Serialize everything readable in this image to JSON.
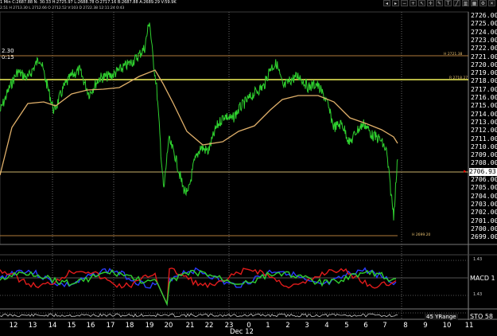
{
  "header": {
    "ohlc_line": "1 Min  C:2687.88  N: 30.33  H:2725.97  L:2688.78  O:2717.16  B:2687.88  A:2689.29  V:59.9K",
    "sub_line": "2.51  H 2713.30  L 2712.66  O 2712.52  V:103  D 2722.38  12:11:24  0:43",
    "left_value_1": "2.30",
    "left_value_2": "0:15"
  },
  "price_axis": {
    "ticks": [
      "2726.00",
      "2725.00",
      "2724.00",
      "2723.00",
      "2722.00",
      "2721.00",
      "2720.00",
      "2719.00",
      "2718.00",
      "2717.00",
      "2716.00",
      "2715.00",
      "2714.00",
      "2713.00",
      "2712.00",
      "2711.00",
      "2710.00",
      "2709.00",
      "2708.00",
      "2707.00",
      "2706.00",
      "2705.00",
      "2704.00",
      "2703.00",
      "2702.00",
      "2701.00",
      "2700.00",
      "2699.00"
    ],
    "current_price": "2706.93"
  },
  "level_labels": {
    "upper": "H 2721.38",
    "yellow": "R 2718.27",
    "lower": "H 2699.20"
  },
  "indicators": {
    "macd_label": "MACD 1",
    "macd_upper": "1.43",
    "macd_lower": "1.43",
    "sto_label": "STO",
    "sto_value": "58",
    "yrange_label": "45 YRange"
  },
  "time_axis": {
    "labels": [
      "12",
      "13",
      "14",
      "15",
      "16",
      "17",
      "18",
      "19",
      "20",
      "21",
      "22",
      "23",
      "0",
      "1",
      "2",
      "3",
      "4",
      "5",
      "6",
      "7",
      "8",
      "9",
      "10",
      "11"
    ],
    "month_label": "Dec 12"
  },
  "colors": {
    "background": "#000000",
    "price_line": "#2fd12f",
    "moving_average": "#e0b06a",
    "yellow_level": "#f4f45a",
    "macd_red": "#e11b1b",
    "macd_blue": "#2a3cff",
    "macd_green": "#2fd12f"
  },
  "icons": [
    "scroll-left-icon",
    "scroll-right-icon",
    "zoom-out-icon",
    "zoom-in-icon",
    "cursor-icon",
    "crosshair-icon",
    "draw-icon",
    "text-icon",
    "line-icon",
    "chart-icon",
    "grid-icon",
    "settings-icon",
    "close-icon"
  ]
}
